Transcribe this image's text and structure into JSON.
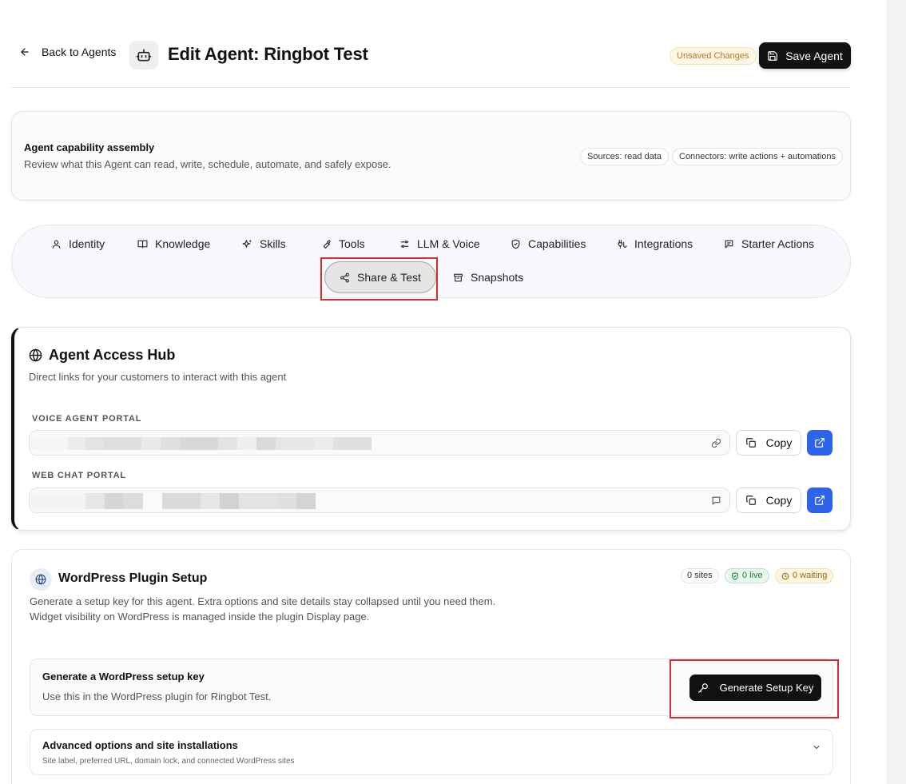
{
  "header": {
    "back_label": "Back to Agents",
    "title": "Edit Agent: Ringbot Test",
    "unsaved_label": "Unsaved Changes",
    "save_label": "Save Agent"
  },
  "capability": {
    "title": "Agent capability assembly",
    "subtitle": "Review what this Agent can read, write, schedule, automate, and safely expose.",
    "pill_sources": "Sources: read data",
    "pill_connectors": "Connectors: write actions + automations"
  },
  "tabs": {
    "identity": "Identity",
    "knowledge": "Knowledge",
    "skills": "Skills",
    "tools": "Tools",
    "llm_voice": "LLM & Voice",
    "capabilities": "Capabilities",
    "integrations": "Integrations",
    "starter_actions": "Starter Actions",
    "share_test": "Share & Test",
    "snapshots": "Snapshots"
  },
  "hub": {
    "title": "Agent Access Hub",
    "subtitle": "Direct links for your customers to interact with this agent",
    "voice_label": "VOICE AGENT PORTAL",
    "webchat_label": "WEB CHAT PORTAL",
    "copy_label": "Copy"
  },
  "wordpress": {
    "title": "WordPress Plugin Setup",
    "desc_line1": "Generate a setup key for this agent. Extra options and site details stay collapsed until you need them.",
    "desc_line2": "Widget visibility on WordPress is managed inside the plugin Display page.",
    "stat_sites": "0 sites",
    "stat_live": "0 live",
    "stat_waiting": "0 waiting",
    "gen_title": "Generate a WordPress setup key",
    "gen_sub": "Use this in the WordPress plugin for Ringbot Test.",
    "gen_button": "Generate Setup Key",
    "adv_title": "Advanced options and site installations",
    "adv_sub": "Site label, preferred URL, domain lock, and connected WordPress sites"
  },
  "colors": {
    "primary_dark": "#111111",
    "accent_blue": "#2e64ea",
    "highlight_red": "#d32f2f",
    "warning_amber": "#b7791f",
    "success_green": "#15803d"
  }
}
